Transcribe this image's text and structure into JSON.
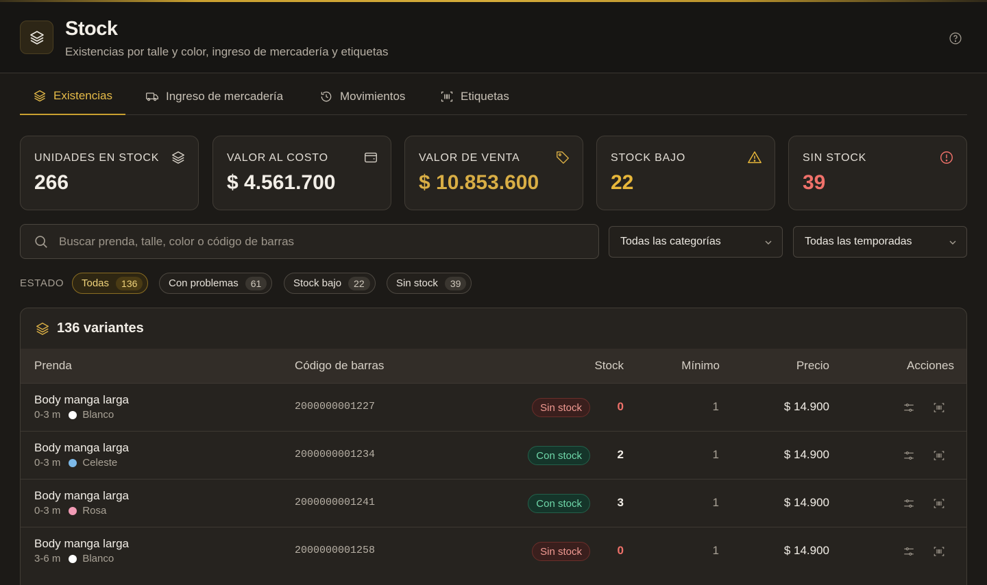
{
  "header": {
    "title": "Stock",
    "subtitle": "Existencias por talle y color, ingreso de mercadería y etiquetas",
    "logo_icon": "layers-icon",
    "help_icon": "help-circle-icon"
  },
  "tabs": [
    {
      "label": "Existencias",
      "icon": "layers-icon",
      "active": true
    },
    {
      "label": "Ingreso de mercadería",
      "icon": "truck-icon",
      "active": false
    },
    {
      "label": "Movimientos",
      "icon": "history-icon",
      "active": false
    },
    {
      "label": "Etiquetas",
      "icon": "barcode-icon",
      "active": false
    }
  ],
  "stats": [
    {
      "label": "UNIDADES EN STOCK",
      "value": "266",
      "icon": "layers-icon",
      "color": "#f2eee7"
    },
    {
      "label": "VALOR AL COSTO",
      "value": "$ 4.561.700",
      "icon": "wallet-icon",
      "color": "#f2eee7"
    },
    {
      "label": "VALOR DE VENTA",
      "value": "$ 10.853.600",
      "icon": "tag-icon",
      "color": "#d9ae45"
    },
    {
      "label": "STOCK BAJO",
      "value": "22",
      "icon": "warning-icon",
      "color": "#e8b73a"
    },
    {
      "label": "SIN STOCK",
      "value": "39",
      "icon": "alert-circle-icon",
      "color": "#f0716a"
    }
  ],
  "search": {
    "placeholder": "Buscar prenda, talle, color o código de barras",
    "value": ""
  },
  "filters": {
    "category": "Todas las categorías",
    "season": "Todas las temporadas"
  },
  "status_filter": {
    "label": "ESTADO",
    "chips": [
      {
        "label": "Todas",
        "count": "136",
        "active": true
      },
      {
        "label": "Con problemas",
        "count": "61",
        "active": false
      },
      {
        "label": "Stock bajo",
        "count": "22",
        "active": false
      },
      {
        "label": "Sin stock",
        "count": "39",
        "active": false
      }
    ]
  },
  "table": {
    "title": "136 variantes",
    "columns": {
      "item": "Prenda",
      "barcode": "Código de barras",
      "stock": "Stock",
      "min": "Mínimo",
      "price": "Precio",
      "actions": "Acciones"
    },
    "rows": [
      {
        "name": "Body manga larga",
        "size": "0-3 m",
        "color": "Blanco",
        "swatch": "#ffffff",
        "barcode": "2000000001227",
        "status": "Sin stock",
        "status_type": "out",
        "stock": "0",
        "min": "1",
        "price": "$ 14.900"
      },
      {
        "name": "Body manga larga",
        "size": "0-3 m",
        "color": "Celeste",
        "swatch": "#7cb9e8",
        "barcode": "2000000001234",
        "status": "Con stock",
        "status_type": "in",
        "stock": "2",
        "min": "1",
        "price": "$ 14.900"
      },
      {
        "name": "Body manga larga",
        "size": "0-3 m",
        "color": "Rosa",
        "swatch": "#f19bb5",
        "barcode": "2000000001241",
        "status": "Con stock",
        "status_type": "in",
        "stock": "3",
        "min": "1",
        "price": "$ 14.900"
      },
      {
        "name": "Body manga larga",
        "size": "3-6 m",
        "color": "Blanco",
        "swatch": "#ffffff",
        "barcode": "2000000001258",
        "status": "Sin stock",
        "status_type": "out",
        "stock": "0",
        "min": "1",
        "price": "$ 14.900"
      }
    ]
  }
}
